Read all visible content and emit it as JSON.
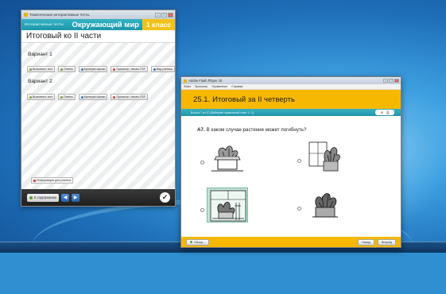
{
  "win1": {
    "titlebar": "Тематические интерактивные тесты",
    "tests_tab": "Интерактивные тесты",
    "subject": "Окружающий мир",
    "grade": "1 класс",
    "title": "Итоговый ко II части",
    "variant1": "Вариант 1",
    "variant2": "Вариант 2",
    "buttons": [
      "Выполнить тест",
      "Ответы",
      "Критерии оценки",
      "Просмотр / печать PDF",
      "Вид ученика"
    ],
    "info_btn": "Информация для учителя",
    "contents_btn": "К содержанию"
  },
  "win2": {
    "titlebar": "Adobe Flash Player 10",
    "menu": [
      "Файл",
      "Просмотр",
      "Управление",
      "Справка"
    ],
    "header_num": "25.1.",
    "header_title": "Итоговый за II четверть",
    "bar_text": "Вопрос 7 из 10 (Выберите правильный ответ 1 / 1)",
    "question_num": "А7.",
    "question": "В каком случае растение может погибнуть?",
    "footer_left": "Обзор...",
    "footer_back": "Назад",
    "footer_next": "Вперёд",
    "selected_answer": 3
  },
  "colors": {
    "teal": "#2aa7b9",
    "yellow": "#f6b800",
    "desktop": "#2f8fd0"
  }
}
